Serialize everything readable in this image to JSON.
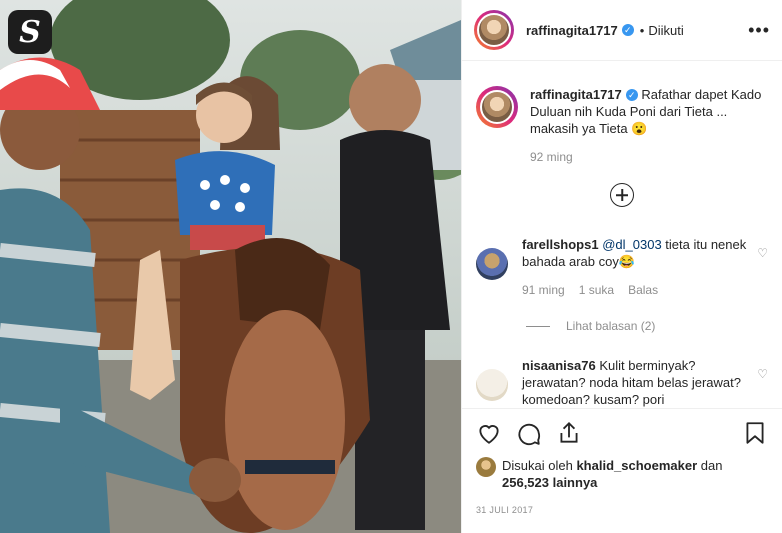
{
  "post": {
    "username": "raffinagita1717",
    "verified_icon": "verified-badge-icon",
    "follow_status": "Diikuti",
    "separator": "•"
  },
  "caption": {
    "username": "raffinagita1717",
    "text": "Rafathar dapet Kado Duluan nih Kuda Poni dari Tieta ... makasih ya Tieta 😮",
    "time": "92 ming"
  },
  "comments": [
    {
      "username": "farellshops1",
      "mention": "@dl_0303",
      "text": " tieta itu nenek bahada arab coy😂",
      "time": "91 ming",
      "likes": "1 suka",
      "reply_label": "Balas",
      "view_replies": "Lihat balasan (2)"
    },
    {
      "username": "nisaanisa76",
      "text": "Kulit berminyak? jerawatan? noda hitam belas jerawat? komedoan? kusam? pori"
    }
  ],
  "liked_by": {
    "prefix": "Disukai oleh",
    "user": "khalid_schoemaker",
    "suffix": "dan",
    "count": "256,523 lainnya"
  },
  "date": "31 JULI 2017",
  "watermark": "S",
  "colors": {
    "verified": "#3897f0",
    "muted": "#8e8e8e",
    "mention": "#003569"
  }
}
